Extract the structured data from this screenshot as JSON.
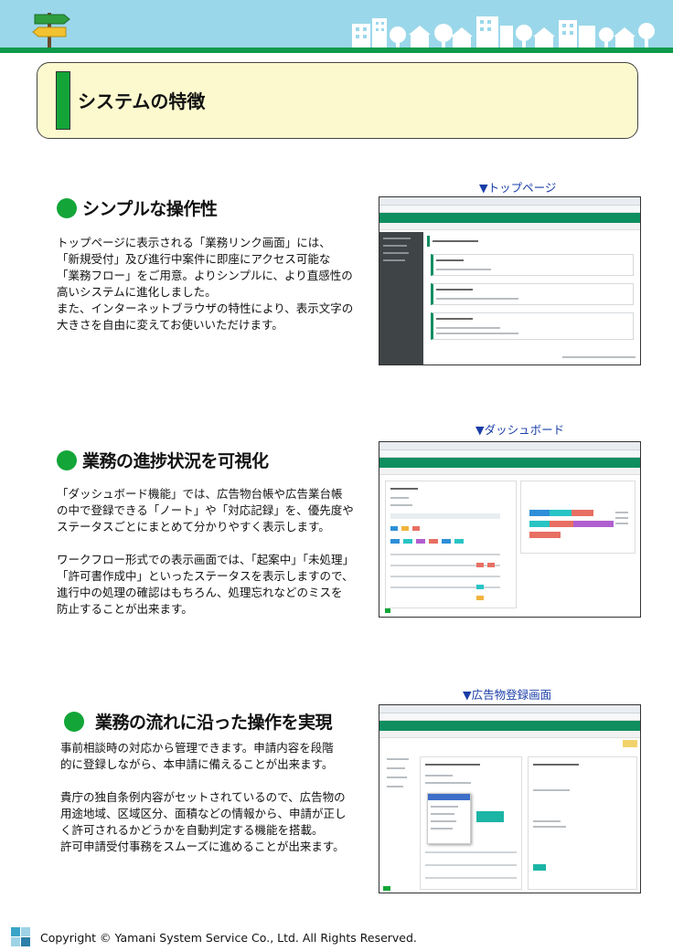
{
  "page": {
    "title": "システムの特徴"
  },
  "sections": [
    {
      "title": "シンプルな操作性",
      "caption": "▼トップページ",
      "body": [
        "トップページに表示される「業務リンク画面」には、",
        "「新規受付」及び進行中案件に即座にアクセス可能な",
        "「業務フロー」をご用意。よりシンプルに、より直感性の",
        "高いシステムに進化しました。",
        "また、インターネットブラウザの特性により、表示文字の",
        "大きさを自由に変えてお使いいただけます。"
      ]
    },
    {
      "title": "業務の進捗状況を可視化",
      "caption": "▼ダッシュボード",
      "body": [
        "「ダッシュボード機能」では、広告物台帳や広告業台帳",
        "の中で登録できる「ノート」や「対応記録」を、優先度や",
        "ステータスごとにまとめて分かりやすく表示します。",
        "",
        "ワークフロー形式での表示画面では、「起案中」「未処理」",
        "「許可書作成中」といったステータスを表示しますので、",
        "進行中の処理の確認はもちろん、処理忘れなどのミスを",
        "防止することが出来ます。"
      ]
    },
    {
      "title": "業務の流れに沿った操作を実現",
      "caption": "▼広告物登録画面",
      "body": [
        "事前相談時の対応から管理できます。申請内容を段階",
        "的に登録しながら、本申請に備えることが出来ます。",
        "",
        "貴庁の独自条例内容がセットされているので、広告物の",
        "用途地域、区域区分、面積などの情報から、申請が正し",
        "く許可されるかどうかを自動判定する機能を搭載。",
        "許可申請受付事務をスムーズに進めることが出来ます。"
      ]
    }
  ],
  "footer": {
    "copyright": "Copyright © Yamani System Service Co., Ltd. All Rights Reserved."
  },
  "colors": {
    "banner": "#9bd7ea",
    "accent_green": "#13a538",
    "title_box": "#fdf9cf",
    "caption_blue": "#1a3ea8",
    "app_green": "#0f8e60"
  }
}
